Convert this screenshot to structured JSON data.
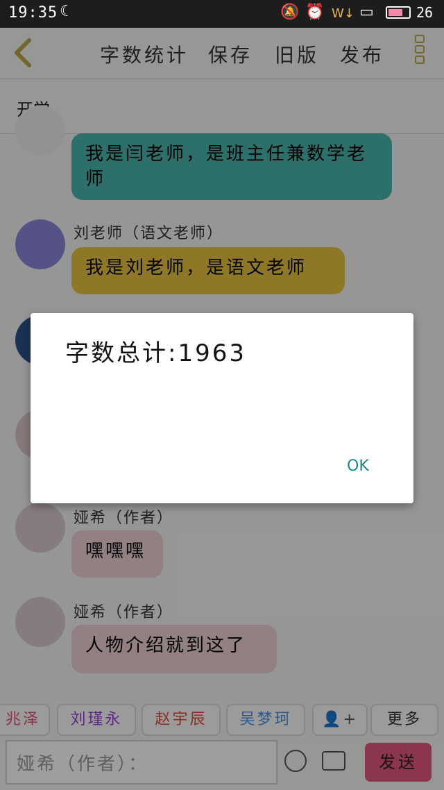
{
  "status": {
    "time": "19:35",
    "battery_level": "26"
  },
  "header": {
    "buttons": [
      "字数统计",
      "保存",
      "旧版",
      "发布"
    ],
    "title": "开学"
  },
  "messages": [
    {
      "name": "",
      "text": "我是闫老师，是班主任兼数学老师",
      "color": "#4ab3ad"
    },
    {
      "name": "刘老师（语文老师）",
      "text": "我是刘老师，是语文老师",
      "color": "#e6c23f"
    },
    {
      "name": "娅希（作者）",
      "text": "嘿嘿嘿",
      "color": "#eccfd3"
    },
    {
      "name": "娅希（作者）",
      "text": "人物介绍就到这了",
      "color": "#eccfd3"
    }
  ],
  "chips": [
    {
      "label": "兆泽",
      "color": "#e05570"
    },
    {
      "label": "刘瑾永",
      "color": "#9a3ed8"
    },
    {
      "label": "赵宇辰",
      "color": "#e04a3a"
    },
    {
      "label": "吴梦珂",
      "color": "#4a90d8"
    },
    {
      "label": "+",
      "color": "#555555"
    },
    {
      "label": "更多",
      "color": "#333333"
    }
  ],
  "input": {
    "placeholder": "娅希（作者）："
  },
  "send_label": "发送",
  "dialog": {
    "message": "字数总计:1963",
    "ok_label": "OK"
  }
}
